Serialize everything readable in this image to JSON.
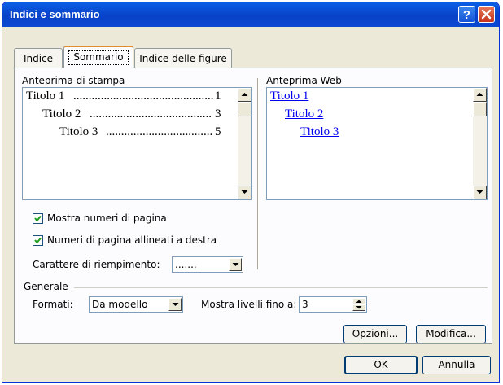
{
  "window": {
    "title": "Indici e sommario"
  },
  "tabs": [
    {
      "label": "Indice",
      "mnemonic": "I",
      "active": false
    },
    {
      "label": "Sommario",
      "mnemonic": "S",
      "active": true
    },
    {
      "label": "Indice delle figure",
      "mnemonic": "f",
      "active": false
    }
  ],
  "print_preview": {
    "label": "Anteprima di stampa",
    "entries": [
      {
        "text": "Titolo 1",
        "page": "1"
      },
      {
        "text": "Titolo 2",
        "page": "3"
      },
      {
        "text": "Titolo 3",
        "page": "5"
      }
    ]
  },
  "web_preview": {
    "label": "Anteprima Web",
    "links": [
      "Titolo 1",
      "Titolo 2",
      "Titolo 3"
    ]
  },
  "options": {
    "show_page_numbers": {
      "label": "Mostra numeri di pagina",
      "checked": true
    },
    "right_align": {
      "label": "Numeri di pagina allineati a destra",
      "checked": true
    },
    "fill_char": {
      "label": "Carattere di riempimento:",
      "value": "......."
    }
  },
  "general": {
    "label": "Generale",
    "formats_label": "Formati:",
    "formats_value": "Da modello",
    "levels_label": "Mostra livelli fino a:",
    "levels_value": "3"
  },
  "buttons": {
    "options": "Opzioni...",
    "modify": "Modifica...",
    "ok": "OK",
    "cancel": "Annulla"
  },
  "colors": {
    "titlebar": "#0842c8",
    "face": "#ece9d8",
    "link": "#0000ee",
    "tab_highlight": "#e68b2c"
  }
}
